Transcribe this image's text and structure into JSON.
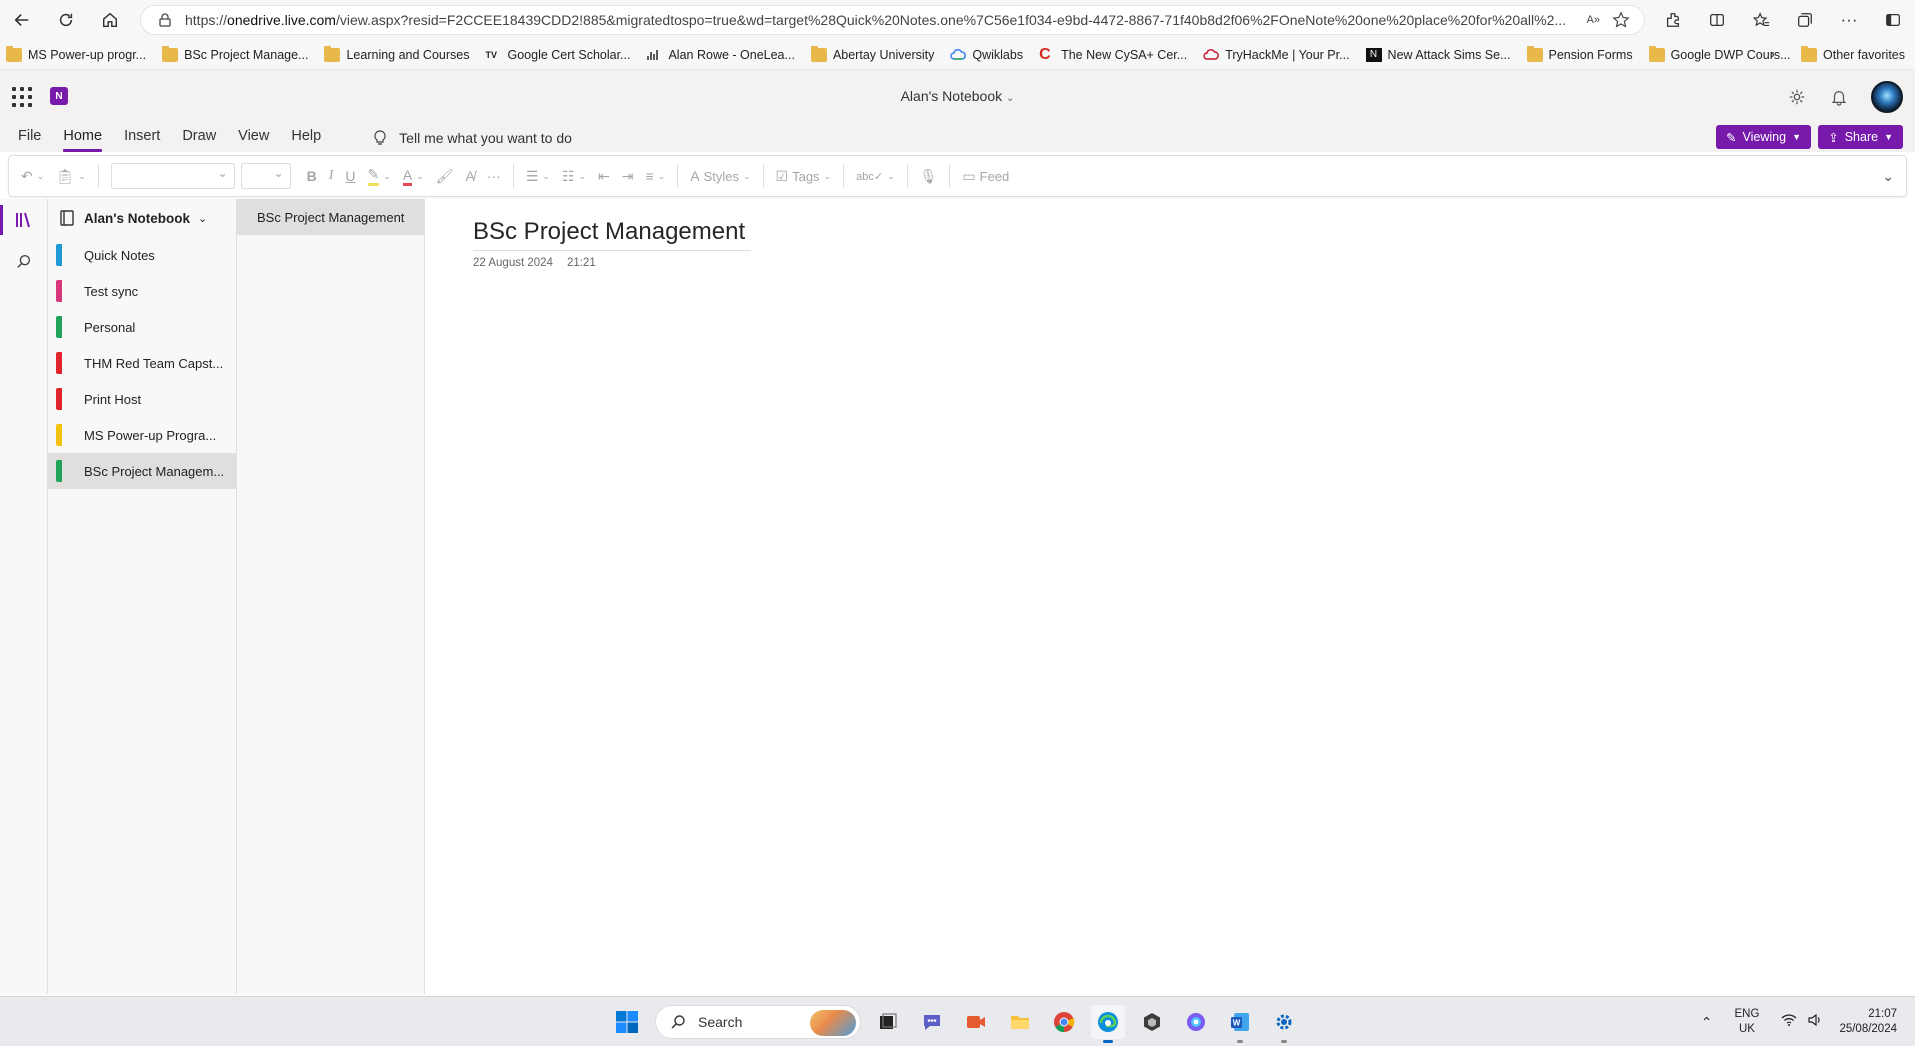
{
  "browser": {
    "url_prefix": "https://",
    "url_domain": "onedrive.live.com",
    "url_rest": "/view.aspx?resid=F2CCEE18439CDD2!885&migratedtospo=true&wd=target%28Quick%20Notes.one%7C56e1f034-e9bd-4472-8867-71f40b8d2f06%2FOneNote%20one%20place%20for%20all%2...",
    "reader_label": "A»"
  },
  "bookmarks": [
    {
      "label": "MS Power-up progr...",
      "icon": "folder"
    },
    {
      "label": "BSc Project Manage...",
      "icon": "folder"
    },
    {
      "label": "Learning and Courses",
      "icon": "folder"
    },
    {
      "label": "Google Cert Scholar...",
      "icon": "tv-icon"
    },
    {
      "label": "Alan Rowe - OneLea...",
      "icon": "chart-icon"
    },
    {
      "label": "Abertay University",
      "icon": "folder"
    },
    {
      "label": "Qwiklabs",
      "icon": "cloud-icon"
    },
    {
      "label": "The New CySA+ Cer...",
      "icon": "c-icon"
    },
    {
      "label": "TryHackMe | Your Pr...",
      "icon": "cloud-outline-icon"
    },
    {
      "label": "New Attack Sims Se...",
      "icon": "n-icon"
    },
    {
      "label": "Pension Forms",
      "icon": "folder"
    },
    {
      "label": "Google DWP Cours...",
      "icon": "folder"
    }
  ],
  "bookmarks_other": "Other favorites",
  "app": {
    "logo_letter": "N",
    "notebook_title": "Alan's Notebook",
    "accent": "#7719aa"
  },
  "ribbon_tabs": [
    {
      "label": "File",
      "active": false
    },
    {
      "label": "Home",
      "active": true
    },
    {
      "label": "Insert",
      "active": false
    },
    {
      "label": "Draw",
      "active": false
    },
    {
      "label": "View",
      "active": false
    },
    {
      "label": "Help",
      "active": false
    }
  ],
  "tell_me": "Tell me what you want to do",
  "viewing_label": "Viewing",
  "share_label": "Share",
  "ribbon": {
    "styles_label": "Styles",
    "tags_label": "Tags",
    "feed_label": "Feed"
  },
  "notebook": {
    "name": "Alan's Notebook",
    "sections": [
      {
        "label": "Quick Notes",
        "color": "#1e9bd7",
        "selected": false
      },
      {
        "label": "Test sync",
        "color": "#d8367a",
        "selected": false
      },
      {
        "label": "Personal",
        "color": "#22a35a",
        "selected": false
      },
      {
        "label": "THM Red Team Capst...",
        "color": "#e0242c",
        "selected": false
      },
      {
        "label": "Print Host",
        "color": "#e0242c",
        "selected": false
      },
      {
        "label": "MS Power-up Progra...",
        "color": "#f4c20d",
        "selected": false
      },
      {
        "label": "BSc Project Managem...",
        "color": "#22a35a",
        "selected": true
      }
    ],
    "pages": [
      {
        "label": "BSc Project Management",
        "selected": true
      }
    ]
  },
  "page": {
    "title": "BSc Project Management",
    "date": "22 August 2024",
    "time": "21:21"
  },
  "taskbar": {
    "search_placeholder": "Search",
    "lang_line1": "ENG",
    "lang_line2": "UK",
    "clock_time": "21:07",
    "clock_date": "25/08/2024"
  }
}
